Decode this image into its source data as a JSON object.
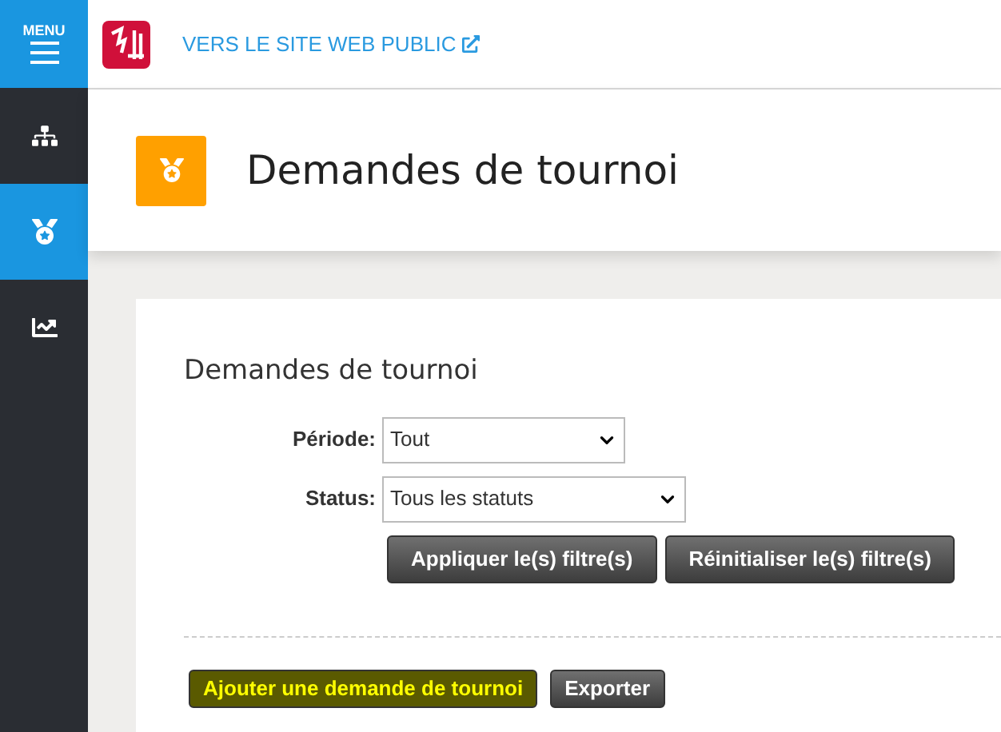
{
  "sidebar": {
    "menu_label": "MENU",
    "items": [
      {
        "kind": "sitemap",
        "selected": false
      },
      {
        "kind": "medal",
        "selected": true
      },
      {
        "kind": "chart",
        "selected": false
      }
    ]
  },
  "topbar": {
    "public_link": "VERS LE SITE WEB PUBLIC"
  },
  "page_header": {
    "title": "Demandes de tournoi"
  },
  "card": {
    "title": "Demandes de tournoi",
    "filters": [
      {
        "label": "Période:",
        "value": "Tout"
      },
      {
        "label": "Status:",
        "value": "Tous les statuts"
      }
    ],
    "filter_buttons": [
      "Appliquer le(s) filtre(s)",
      "Réinitialiser le(s) filtre(s)"
    ],
    "actions": [
      {
        "label": "Ajouter une demande de tournoi",
        "kind": "primary"
      },
      {
        "label": "Exporter",
        "kind": "default"
      }
    ]
  }
}
